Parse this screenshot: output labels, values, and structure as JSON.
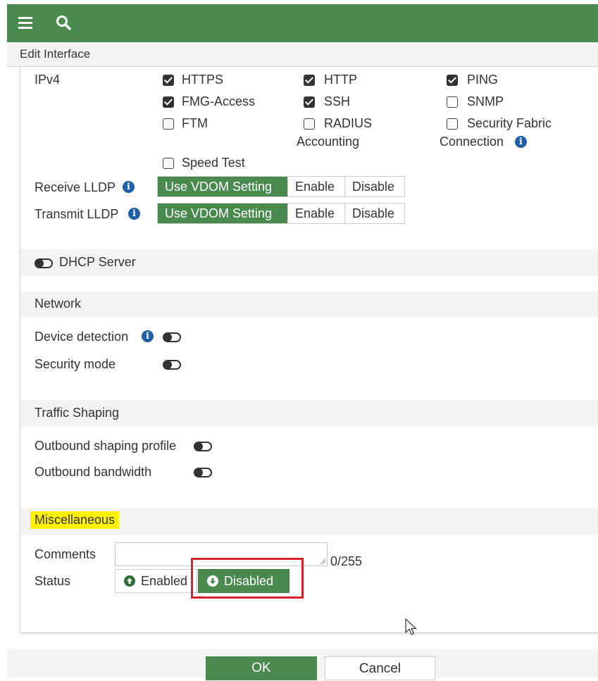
{
  "topbar": {
    "menu_icon": "hamburger-menu-icon",
    "search_icon": "search-icon",
    "color": "#4a8a4f"
  },
  "title": "Edit Interface",
  "ipv4": {
    "label": "IPv4",
    "options": [
      {
        "label": "HTTPS",
        "checked": true
      },
      {
        "label": "HTTP",
        "checked": true
      },
      {
        "label": "PING",
        "checked": true
      },
      {
        "label": "FMG-Access",
        "checked": true
      },
      {
        "label": "SSH",
        "checked": true
      },
      {
        "label": "SNMP",
        "checked": false
      },
      {
        "label": "FTM",
        "checked": false
      },
      {
        "label_line1": "RADIUS",
        "label_line2": "Accounting",
        "checked": false
      },
      {
        "label_line1": "Security Fabric",
        "label_line2": "Connection",
        "checked": false
      },
      {
        "label": "Speed Test",
        "checked": false
      }
    ]
  },
  "lldp": {
    "receive_label": "Receive LLDP",
    "transmit_label": "Transmit LLDP",
    "options": [
      "Use VDOM Setting",
      "Enable",
      "Disable"
    ],
    "receive_selected": "Use VDOM Setting",
    "transmit_selected": "Use VDOM Setting"
  },
  "dhcp": {
    "label": "DHCP Server",
    "enabled": false
  },
  "network": {
    "title": "Network",
    "device_detection": "Device detection",
    "security_mode": "Security mode"
  },
  "traffic": {
    "title": "Traffic Shaping",
    "outbound_profile": "Outbound shaping profile",
    "outbound_bandwidth": "Outbound bandwidth"
  },
  "misc": {
    "title": "Miscellaneous",
    "comments_label": "Comments",
    "comments_value": "",
    "counter": "0/255",
    "status_label": "Status",
    "enabled_label": "Enabled",
    "disabled_label": "Disabled",
    "selected": "Disabled"
  },
  "footer": {
    "ok": "OK",
    "cancel": "Cancel"
  },
  "colors": {
    "accent": "#4a8a4f",
    "info": "#1f5ea8",
    "highlight": "#fff200",
    "annotation": "#d9232b"
  }
}
